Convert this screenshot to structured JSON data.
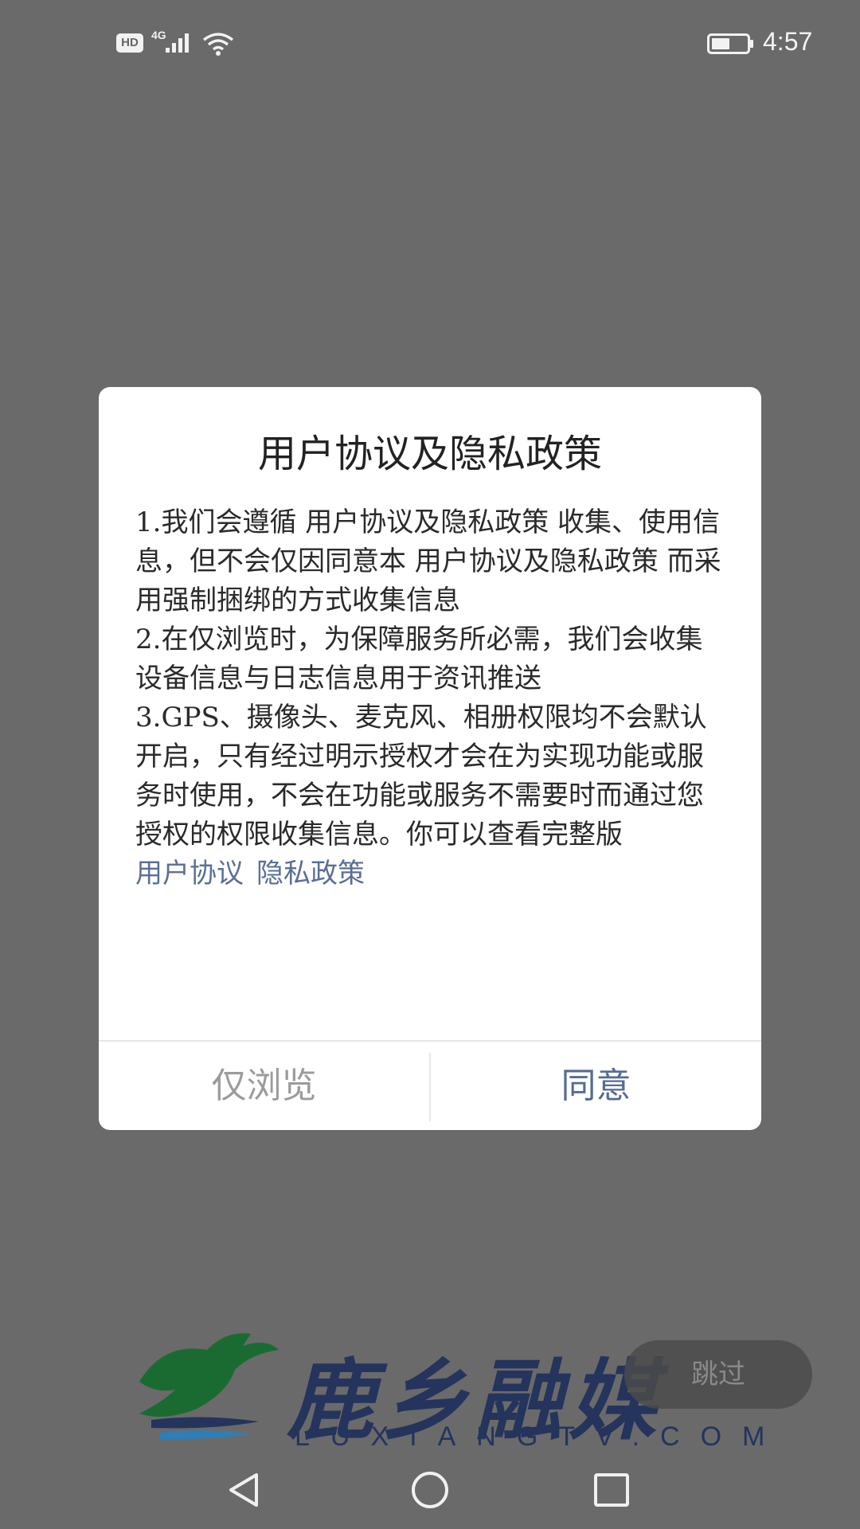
{
  "status_bar": {
    "hd": "HD",
    "network": "4G",
    "time": "4:57",
    "icons": [
      "signal-icon",
      "wifi-icon",
      "battery-icon"
    ]
  },
  "dialog": {
    "title": "用户协议及隐私政策",
    "paragraphs": [
      "1.我们会遵循 用户协议及隐私政策 收集、使用信息，但不会仅因同意本 用户协议及隐私政策 而采用强制捆绑的方式收集信息",
      "2.在仅浏览时，为保障服务所必需，我们会收集设备信息与日志信息用于资讯推送",
      "3.GPS、摄像头、麦克风、相册权限均不会默认开启，只有经过明示授权才会在为实现功能或服务时使用，不会在功能或服务不需要时而通过您授权的权限收集信息。你可以查看完整版"
    ],
    "links": {
      "user_agreement": "用户协议",
      "privacy_policy": "隐私政策"
    },
    "buttons": {
      "browse_only": "仅浏览",
      "agree": "同意"
    }
  },
  "brand": {
    "name": "鹿乡融媒",
    "url": "LUXIANGTV.COM"
  },
  "skip_button": "跳过",
  "colors": {
    "overlay": "#6a6a6a",
    "link": "#5a6f96",
    "agree": "#566b93",
    "browse": "#9b9b9b",
    "brand_blue": "#24345c",
    "brand_green": "#1a6b32"
  },
  "nav_bar": {
    "icons": [
      "back-icon",
      "home-icon",
      "recent-apps-icon"
    ]
  }
}
